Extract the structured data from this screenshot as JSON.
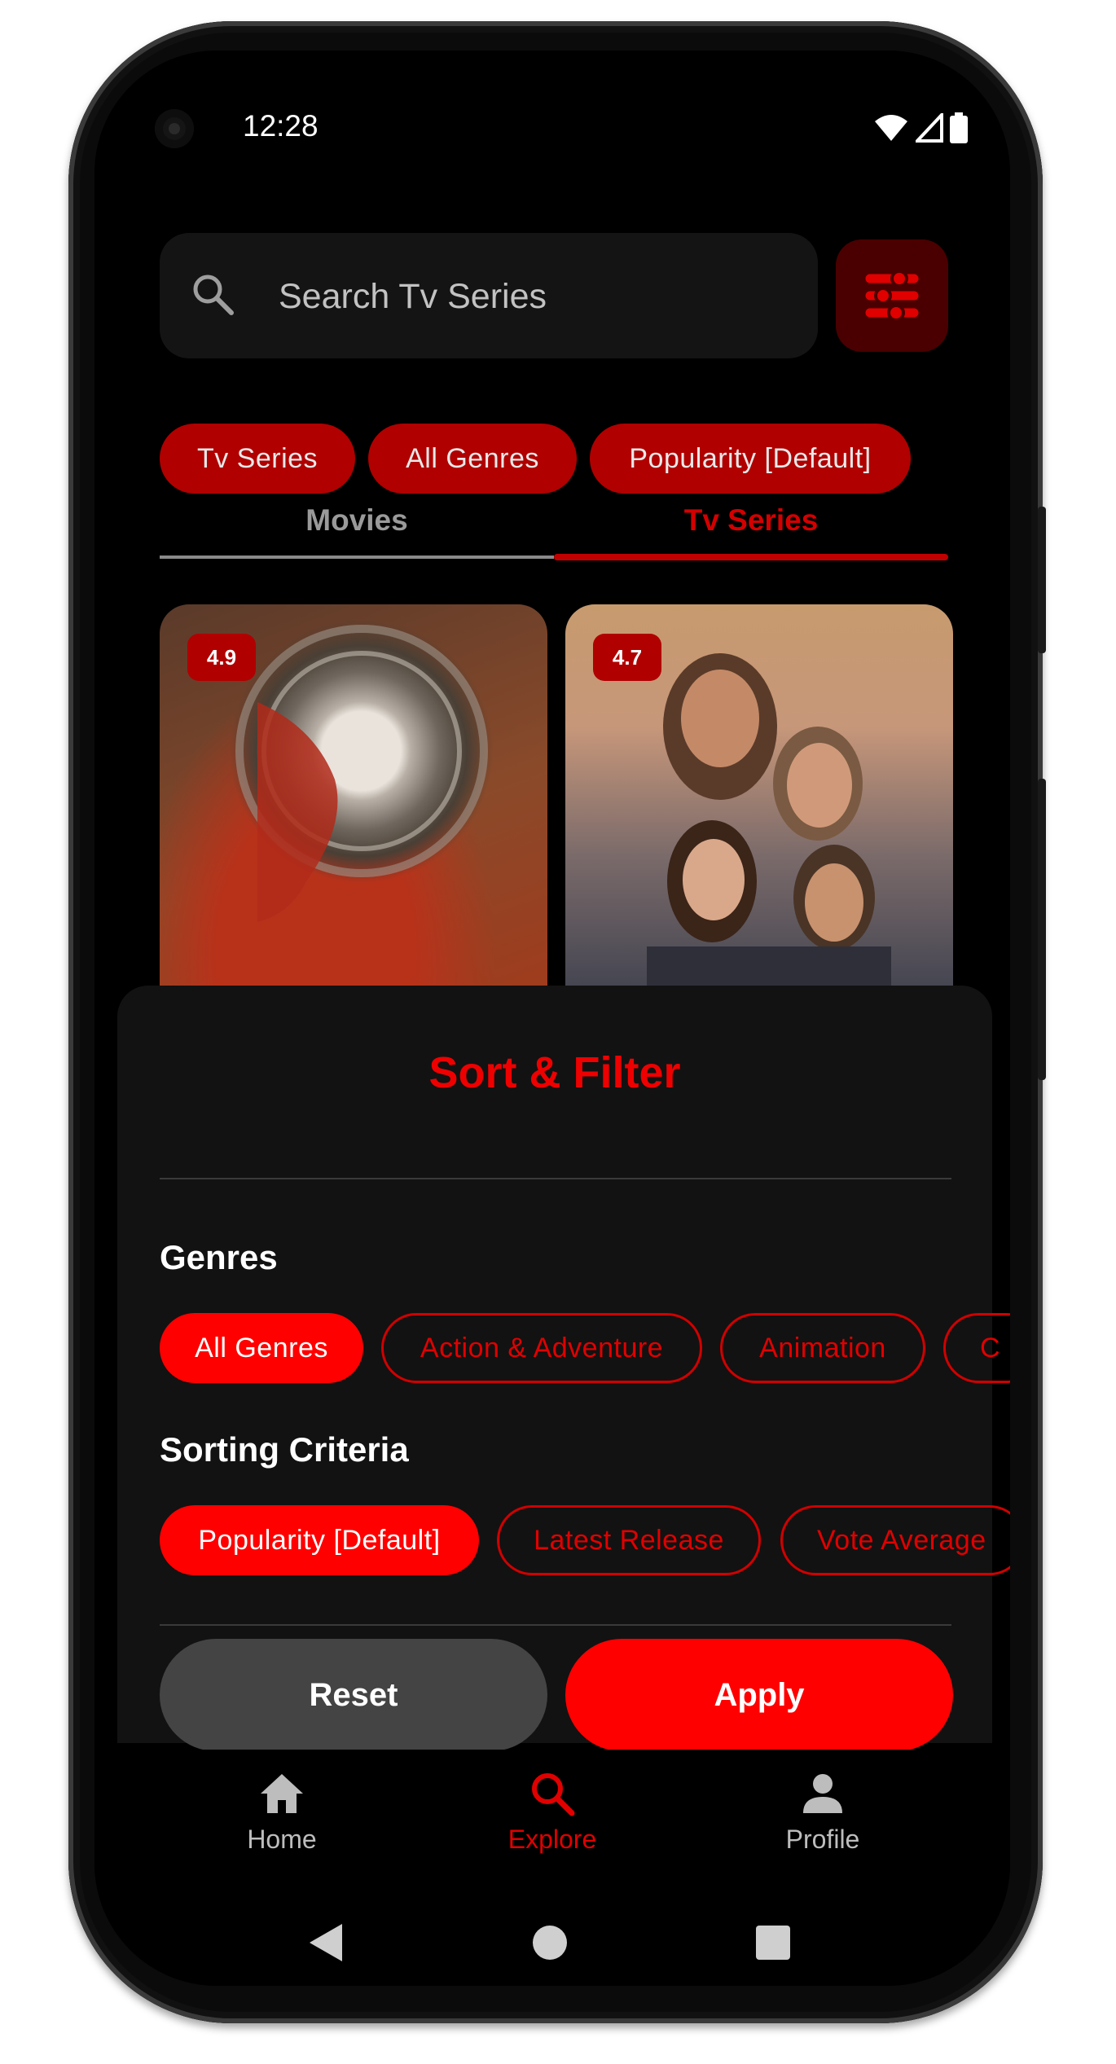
{
  "status_bar": {
    "time": "12:28"
  },
  "search": {
    "placeholder": "Search Tv Series"
  },
  "active_filters": [
    "Tv Series",
    "All Genres",
    "Popularity [Default]"
  ],
  "tabs": [
    {
      "label": "Movies",
      "active": false
    },
    {
      "label": "Tv Series",
      "active": true
    }
  ],
  "cards": [
    {
      "rating": "4.9"
    },
    {
      "rating": "4.7"
    }
  ],
  "sheet": {
    "title": "Sort & Filter",
    "genres_title": "Genres",
    "genres": [
      "All Genres",
      "Action & Adventure",
      "Animation",
      "C"
    ],
    "selected_genre": "All Genres",
    "sorting_title": "Sorting Criteria",
    "sorting": [
      "Popularity [Default]",
      "Latest Release",
      "Vote Average"
    ],
    "selected_sorting": "Popularity [Default]",
    "reset_label": "Reset",
    "apply_label": "Apply"
  },
  "bottom_nav": [
    {
      "label": "Home",
      "icon": "home-icon",
      "active": false
    },
    {
      "label": "Explore",
      "icon": "search-icon",
      "active": true
    },
    {
      "label": "Profile",
      "icon": "person-icon",
      "active": false
    }
  ],
  "colors": {
    "accent": "#ff0000",
    "accent_dark": "#b00000",
    "background": "#000000",
    "sheet": "#121212"
  }
}
